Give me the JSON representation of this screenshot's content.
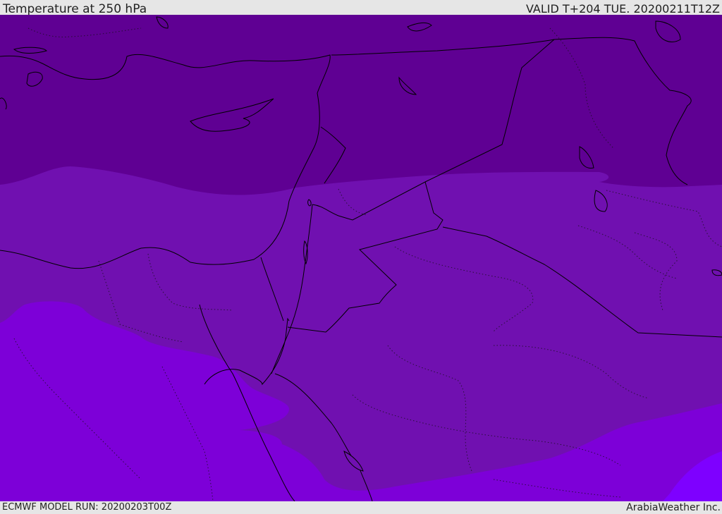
{
  "header": {
    "title": "Temperature at 250 hPa",
    "valid_time": "VALID T+204 TUE. 20200211T12Z"
  },
  "footer": {
    "model_run": "ECMWF MODEL RUN: 20200203T00Z",
    "brand": "ArabiaWeather Inc."
  },
  "colors": {
    "band_coldest": "#5f0093",
    "band_cold": "#7010b0",
    "band_mid": "#7d00d8",
    "band_warm": "#7e00ff",
    "coastline": "#000000",
    "borders": "#000000"
  }
}
